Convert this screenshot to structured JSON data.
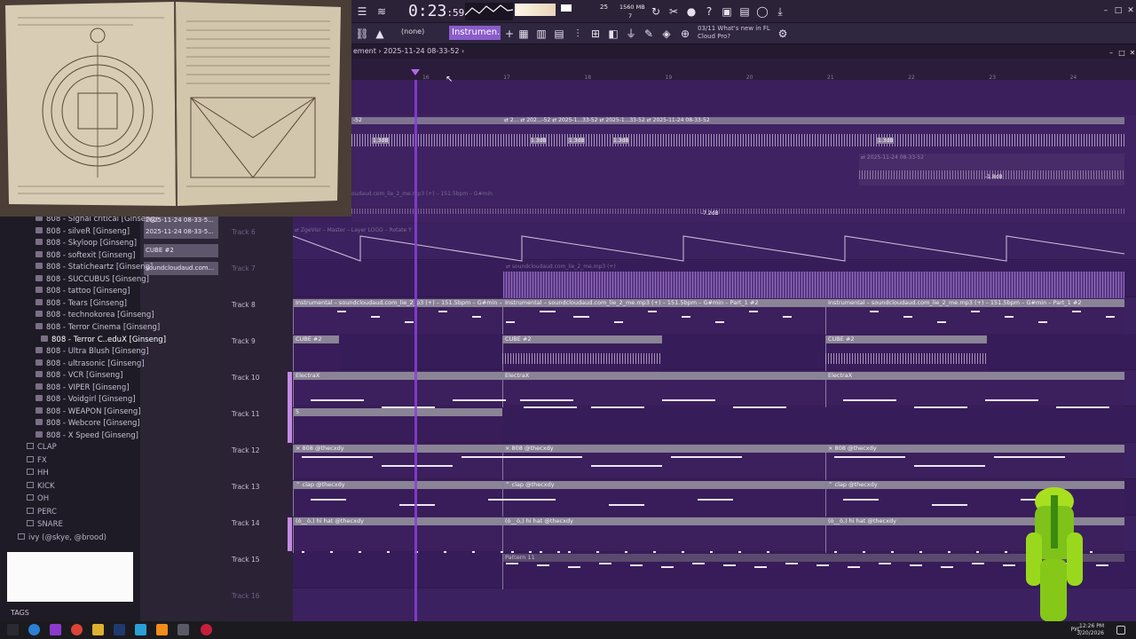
{
  "toolbar": {
    "time_main": "0:23",
    "time_sub": ":59",
    "tempo_value": "25",
    "memory": "1560 MB",
    "memory_sub": "7",
    "pattern_selector": "(none)",
    "pattern_name": "Instrumen...#2",
    "news_line1": "03/11  What's new in FL",
    "news_line2": "Cloud Pro?"
  },
  "playlist": {
    "breadcrumb": "ement › 2025-11-24 08-33-52 ›",
    "ruler_ticks": [
      "16",
      "17",
      "18",
      "19",
      "20",
      "21",
      "22",
      "23",
      "24"
    ]
  },
  "audio_clips": {
    "top_left": "-52",
    "top_row": "⇄ 2... ⇄ 202...-52 ⇄ 2025-1...33-52 ⇄ 2025-1...33-52 ⇄ 2025-11-24 08-33-52",
    "gain1": "1.3dB",
    "gain2": "1.3dB",
    "gain3": "1.3dB",
    "gain4": "1.3dB",
    "gain5": "1.3dB",
    "dup_clip": "⇄ 2025-11-24 08-33-52",
    "dup_gain": "-1.8dB",
    "sc_row": "oudaud.com_lie_2_me.mp3 (+) – 151.5bpm – G#min",
    "sc_gain": "-7.2dB"
  },
  "picker": [
    "2025-11-24 08-33-5...",
    "CUBE #2",
    "soundcloudaud.com..."
  ],
  "browser": {
    "items": [
      "808 - Signal critical [Ginseng]",
      "808 - silveR [Ginseng]",
      "808 - Skyloop [Ginseng]",
      "808 - softexit [Ginseng]",
      "808 - Staticheartz [Ginseng]",
      "808 - SUCCUBUS [Ginseng]",
      "808 - tattoo [Ginseng]",
      "808 - Tears [Ginseng]",
      "808 - technokorea [Ginseng]",
      "808 - Terror Cinema [Ginseng]",
      "808 - Terror C..eduX [Ginseng]",
      "808 - Ultra Blush [Ginseng]",
      "808 - ultrasonic [Ginseng]",
      "808 - VCR [Ginseng]",
      "808 - VIPER [Ginseng]",
      "808 - Voidgirl [Ginseng]",
      "808 - WEAPON [Ginseng]",
      "808 - Webcore [Ginseng]",
      "808 - X Speed [Ginseng]"
    ],
    "folders": [
      "CLAP",
      "FX",
      "HH",
      "KICK",
      "OH",
      "PERC",
      "SNARE"
    ],
    "root_folder": "ivy (@skye, @brood)",
    "tags_label": "TAGS"
  },
  "tracks": [
    "Track 6",
    "Track 7",
    "Track 8",
    "Track 9",
    "Track 10",
    "Track 11",
    "Track 12",
    "Track 13",
    "Track 14",
    "Track 15",
    "Track 16"
  ],
  "clips": {
    "zgevst": "⇄ ZgeVisr – Master – Layer LOGO – Rotate Y",
    "sc_small": "⇄ soundcloudaud.com_lie_2_me.mp3 (+)",
    "instr1": "Instrumental – soundcloudaud.com_lie_2_p3 (+) – 151.5bpm – G#min – Part_1 #2",
    "instr2": "Instrumental – soundcloudaud.com_lie_2_me.mp3 (+) – 151.5bpm – G#min – Part_1 #2",
    "instr3": "Instrumental – soundcloudaud.com_lie_2_me.mp3 (+) – 151.5bpm – G#min – Part_1 #2",
    "cube": "CUBE #2",
    "electrax": "ElectraX",
    "track11": "5",
    "e808": "× 808 @thecxdy",
    "clap": "⌃ clap @thecxdy",
    "hihat": "(ó__ò,) hi hat @thecxdy",
    "pattern11": "Pattern 11"
  },
  "taskbar": {
    "lang": "РУС",
    "time": "12:26 PM",
    "date": "3/20/2026"
  }
}
